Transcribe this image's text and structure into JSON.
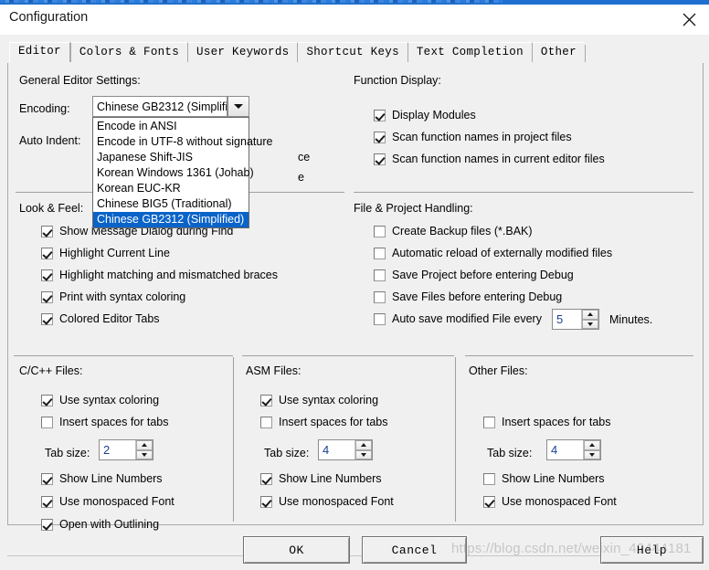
{
  "window": {
    "title": "Configuration",
    "close_icon": "close-icon"
  },
  "tabs": [
    {
      "label": "Editor",
      "active": true
    },
    {
      "label": "Colors & Fonts",
      "active": false
    },
    {
      "label": "User Keywords",
      "active": false
    },
    {
      "label": "Shortcut Keys",
      "active": false
    },
    {
      "label": "Text Completion",
      "active": false
    },
    {
      "label": "Other",
      "active": false
    }
  ],
  "general": {
    "section_title": "General Editor Settings:",
    "encoding_label": "Encoding:",
    "auto_indent_label": "Auto Indent:",
    "encoding_value": "Chinese GB2312 (Simplified)",
    "dropdown_open": true,
    "dropdown_items": [
      {
        "label": "Encode in ANSI",
        "selected": false
      },
      {
        "label": "Encode in UTF-8 without signature",
        "selected": false
      },
      {
        "label": "Japanese Shift-JIS",
        "selected": false
      },
      {
        "label": "Korean Windows 1361 (Johab)",
        "selected": false
      },
      {
        "label": "Korean EUC-KR",
        "selected": false
      },
      {
        "label": "Chinese BIG5 (Traditional)",
        "selected": false
      },
      {
        "label": "Chinese GB2312 (Simplified)",
        "selected": true
      }
    ],
    "obscured_fragment_1": "ce",
    "obscured_fragment_2": "e"
  },
  "function_display": {
    "section_title": "Function Display:",
    "items": [
      {
        "label": "Display Modules",
        "checked": true
      },
      {
        "label": "Scan function names in project files",
        "checked": true
      },
      {
        "label": "Scan function names in current editor files",
        "checked": true
      }
    ]
  },
  "look_and_feel": {
    "section_title": "Look & Feel:",
    "items": [
      {
        "label": "Show Message Dialog during Find",
        "checked": true
      },
      {
        "label": "Highlight Current Line",
        "checked": true
      },
      {
        "label": "Highlight matching and mismatched braces",
        "checked": true
      },
      {
        "label": "Print with syntax coloring",
        "checked": true
      },
      {
        "label": "Colored Editor Tabs",
        "checked": true
      }
    ]
  },
  "file_project": {
    "section_title": "File & Project Handling:",
    "items": [
      {
        "label": "Create Backup files (*.BAK)",
        "checked": false
      },
      {
        "label": "Automatic reload of externally modified files",
        "checked": false
      },
      {
        "label": "Save Project before entering Debug",
        "checked": false
      },
      {
        "label": "Save Files before entering Debug",
        "checked": false
      },
      {
        "label": "Auto save modified File every",
        "checked": false
      }
    ],
    "autosave_value": "5",
    "autosave_suffix": "Minutes."
  },
  "c_files": {
    "section_title": "C/C++ Files:",
    "syntax_coloring": {
      "label": "Use syntax coloring",
      "checked": true
    },
    "insert_spaces": {
      "label": "Insert spaces for tabs",
      "checked": false
    },
    "tab_size_label": "Tab size:",
    "tab_size_value": "2",
    "line_numbers": {
      "label": "Show Line Numbers",
      "checked": true
    },
    "monospaced": {
      "label": "Use monospaced Font",
      "checked": true
    },
    "outlining": {
      "label": "Open with Outlining",
      "checked": true
    }
  },
  "asm_files": {
    "section_title": "ASM Files:",
    "syntax_coloring": {
      "label": "Use syntax coloring",
      "checked": true
    },
    "insert_spaces": {
      "label": "Insert spaces for tabs",
      "checked": false
    },
    "tab_size_label": "Tab size:",
    "tab_size_value": "4",
    "line_numbers": {
      "label": "Show Line Numbers",
      "checked": true
    },
    "monospaced": {
      "label": "Use monospaced Font",
      "checked": true
    }
  },
  "other_files": {
    "section_title": "Other Files:",
    "insert_spaces": {
      "label": "Insert spaces for tabs",
      "checked": false
    },
    "tab_size_label": "Tab size:",
    "tab_size_value": "4",
    "line_numbers": {
      "label": "Show Line Numbers",
      "checked": false
    },
    "monospaced": {
      "label": "Use monospaced Font",
      "checked": true
    }
  },
  "buttons": {
    "ok": "OK",
    "cancel": "Cancel",
    "help": "Help"
  },
  "watermark": "https://blog.csdn.net/weixin_42444181",
  "colors": {
    "selection_blue": "#0a63c8",
    "titlebar_accent": "#1f6fd0",
    "dialog_bg": "#f0f0f0",
    "border": "#a9a9a9"
  }
}
